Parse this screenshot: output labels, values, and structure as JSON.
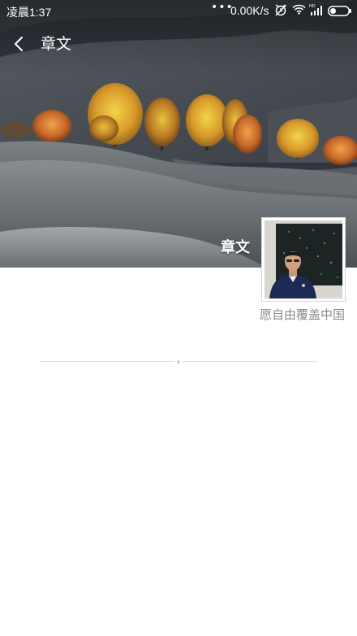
{
  "status_bar": {
    "time": "凌晨1:37",
    "dots": "•••",
    "network_speed": "0.00K/s",
    "signal_tag": "HD",
    "icons": [
      "alarm-off-icon",
      "wifi-icon",
      "signal-icon",
      "battery-icon"
    ]
  },
  "title_bar": {
    "back_icon": "chevron-left-icon",
    "title": "章文"
  },
  "profile": {
    "name": "章文",
    "signature": "愿自由覆盖中国"
  },
  "colors": {
    "title_text": "#ffffff",
    "signature_text": "#8a8a8a",
    "divider": "#e0e0e0",
    "background": "#ffffff"
  }
}
